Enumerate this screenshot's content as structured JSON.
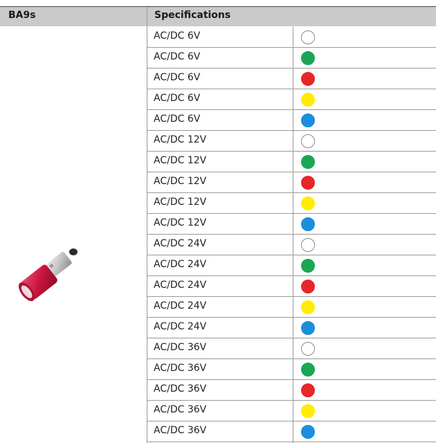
{
  "header": {
    "product_label": "BA9s",
    "spec_label": "Specifications"
  },
  "colors": {
    "white": {
      "fill": "#ffffff",
      "border": "#8a8a8a"
    },
    "green": {
      "fill": "#1aa654",
      "border": "#1aa654"
    },
    "red": {
      "fill": "#e8262a",
      "border": "#e8262a"
    },
    "yellow": {
      "fill": "#ffec00",
      "border": "#ffec00"
    },
    "blue": {
      "fill": "#1a8fdc",
      "border": "#1a8fdc"
    }
  },
  "rows": [
    {
      "spec": "AC/DC 6V",
      "color": "white"
    },
    {
      "spec": "AC/DC 6V",
      "color": "green"
    },
    {
      "spec": "AC/DC 6V",
      "color": "red"
    },
    {
      "spec": "AC/DC 6V",
      "color": "yellow"
    },
    {
      "spec": "AC/DC 6V",
      "color": "blue"
    },
    {
      "spec": "AC/DC 12V",
      "color": "white"
    },
    {
      "spec": "AC/DC 12V",
      "color": "green"
    },
    {
      "spec": "AC/DC 12V",
      "color": "red"
    },
    {
      "spec": "AC/DC 12V",
      "color": "yellow"
    },
    {
      "spec": "AC/DC 12V",
      "color": "blue"
    },
    {
      "spec": "AC/DC 24V",
      "color": "white"
    },
    {
      "spec": "AC/DC 24V",
      "color": "green"
    },
    {
      "spec": "AC/DC 24V",
      "color": "red"
    },
    {
      "spec": "AC/DC 24V",
      "color": "yellow"
    },
    {
      "spec": "AC/DC 24V",
      "color": "blue"
    },
    {
      "spec": "AC/DC 36V",
      "color": "white"
    },
    {
      "spec": "AC/DC 36V",
      "color": "green"
    },
    {
      "spec": "AC/DC 36V",
      "color": "red"
    },
    {
      "spec": "AC/DC 36V",
      "color": "yellow"
    },
    {
      "spec": "AC/DC 36V",
      "color": "blue"
    }
  ],
  "product_image": {
    "icon": "ba9s-led-bulb-icon",
    "body_color": "#c8143c"
  }
}
